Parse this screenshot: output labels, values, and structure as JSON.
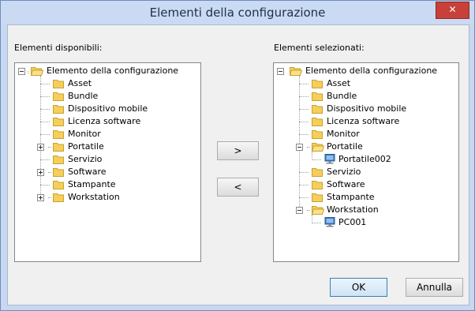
{
  "window": {
    "title": "Elementi della configurazione",
    "close_glyph": "✕"
  },
  "available": {
    "label": "Elementi disponibili:",
    "root": "Elemento della configurazione",
    "items": [
      "Asset",
      "Bundle",
      "Dispositivo mobile",
      "Licenza software",
      "Monitor",
      "Portatile",
      "Servizio",
      "Software",
      "Stampante",
      "Workstation"
    ]
  },
  "selected": {
    "label": "Elementi selezionati:",
    "root": "Elemento della configurazione",
    "items": [
      "Asset",
      "Bundle",
      "Dispositivo mobile",
      "Licenza software",
      "Monitor",
      "Portatile",
      "Portatile002",
      "Servizio",
      "Software",
      "Stampante",
      "Workstation",
      "PC001"
    ]
  },
  "buttons": {
    "add": ">",
    "remove": "<",
    "ok": "OK",
    "cancel": "Annulla"
  },
  "colors": {
    "folder": "#f5cf5a",
    "folder_edge": "#c9a22e",
    "computer": "#3b78c3"
  }
}
